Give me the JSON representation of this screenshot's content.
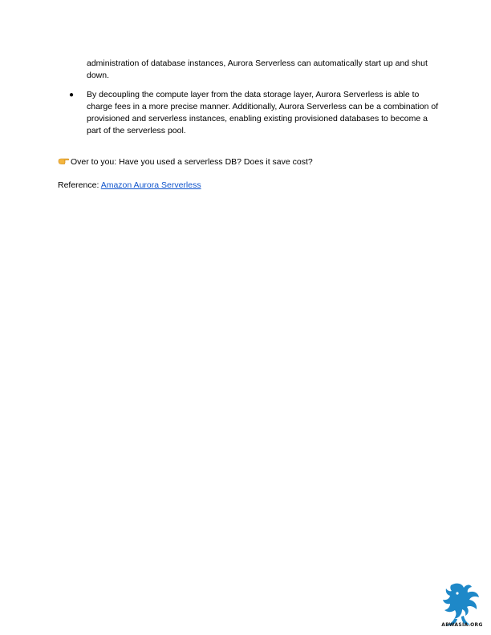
{
  "content": {
    "continuation_text": "administration of database instances, Aurora Serverless can automatically start up and shut down.",
    "bullet": {
      "marker": "●",
      "text": "By decoupling the compute layer from the data storage layer, Aurora Serverless is able to charge fees in a more precise manner. Additionally, Aurora Serverless can be a combination of provisioned and serverless instances, enabling existing provisioned databases to become a part of the serverless pool."
    },
    "call_to_action": {
      "icon": "pointing-hand-icon",
      "text": "Over to you: Have you used a serverless DB? Does it save cost?"
    },
    "reference": {
      "label": "Reference: ",
      "link_text": "Amazon Aurora Serverless"
    }
  },
  "watermark": {
    "text": "ABWASIA.ORG",
    "icon": "griffin-logo-icon",
    "color": "#1e88c8"
  },
  "colors": {
    "link": "#1155cc",
    "text": "#000000"
  }
}
